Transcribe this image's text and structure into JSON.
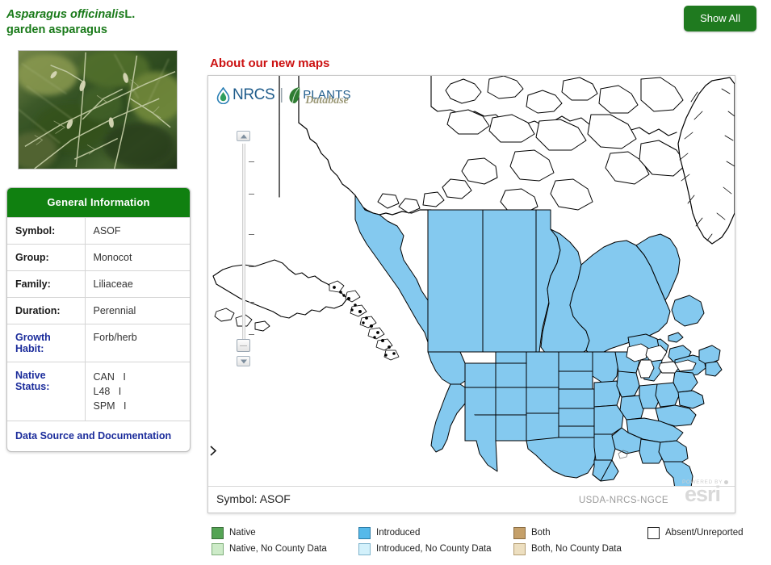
{
  "header": {
    "scientific_name": "Asparagus officinalis",
    "authority": "L.",
    "common_name": "garden asparagus",
    "show_all_label": "Show All"
  },
  "photo": {
    "alt": "garden asparagus plant photograph"
  },
  "info_panel": {
    "title": "General Information",
    "rows": [
      {
        "label": "Symbol:",
        "value": "ASOF",
        "link": false
      },
      {
        "label": "Group:",
        "value": "Monocot",
        "link": false
      },
      {
        "label": "Family:",
        "value": "Liliaceae",
        "link": false
      },
      {
        "label": "Duration:",
        "value": "Perennial",
        "link": false
      },
      {
        "label": "Growth Habit:",
        "value": "Forb/herb",
        "link": true
      }
    ],
    "native_status": {
      "label": "Native Status:",
      "entries": [
        {
          "region": "CAN",
          "status": "I"
        },
        {
          "region": "L48",
          "status": "I"
        },
        {
          "region": "SPM",
          "status": "I"
        }
      ]
    },
    "footer_link": "Data Source and Documentation"
  },
  "map": {
    "heading": "About our new maps",
    "logo": {
      "nrcs": "NRCS",
      "separator": "|",
      "plants": "PLANTS",
      "database": "Database"
    },
    "zoom": {
      "zoom_in_label": "+",
      "zoom_out_label": "-",
      "tick_count": 6,
      "thumb_position_percent": 93
    },
    "footer": {
      "symbol": "Symbol: ASOF",
      "credit": "USDA-NRCS-NGCE",
      "esri_powered_by": "POWERED BY",
      "esri_word": "esri"
    },
    "fill_status": "Introduced",
    "fill_color": "#84c9ef",
    "stroke_color": "#000000"
  },
  "legend": {
    "items": [
      {
        "label": "Native",
        "color": "#55a455",
        "border": "#3c6f3c"
      },
      {
        "label": "Introduced",
        "color": "#55b9ea",
        "border": "#2d7ea8"
      },
      {
        "label": "Both",
        "color": "#c5a06a",
        "border": "#8a6c42"
      },
      {
        "label": "Absent/Unreported",
        "color": "#ffffff",
        "border": "#222222"
      },
      {
        "label": "Native, No County Data",
        "color": "#cdebc8",
        "border": "#7fae7a"
      },
      {
        "label": "Introduced, No County Data",
        "color": "#d3f1fb",
        "border": "#7fb4cc"
      },
      {
        "label": "Both, No County Data",
        "color": "#eddfc0",
        "border": "#b49d72"
      }
    ]
  },
  "colors": {
    "title_green": "#1a7a1a",
    "button_green": "#1f7a1f",
    "panel_header_green": "#108010",
    "heading_red": "#cc1111",
    "link_blue": "#1b2c9b"
  }
}
